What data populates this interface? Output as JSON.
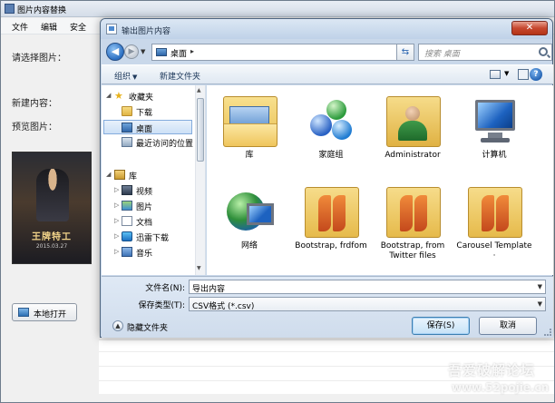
{
  "main_window": {
    "title": "图片内容替换",
    "menu": [
      "文件",
      "编辑",
      "安全"
    ],
    "labels": {
      "select_image": "请选择图片：",
      "new_content": "新建内容：",
      "preview": "预览图片："
    },
    "poster": {
      "title": "王牌特工",
      "date": "2015.03.27"
    },
    "local_open_label": "本地打开"
  },
  "dialog": {
    "title": "输出图片内容",
    "close_glyph": "✕",
    "address": {
      "location": "桌面",
      "separator": "▸"
    },
    "search_placeholder": "搜索 桌面",
    "toolbar": {
      "organize": "组织",
      "new_folder": "新建文件夹"
    },
    "nav_pane": {
      "items": [
        {
          "label": "收藏夹",
          "icon": "star-icon",
          "expander": "◢"
        },
        {
          "label": "下载",
          "icon": "folder-icon"
        },
        {
          "label": "桌面",
          "icon": "desktop-icon",
          "selected": true
        },
        {
          "label": "最近访问的位置",
          "icon": "recent-places-icon"
        },
        {
          "label": "库",
          "icon": "library-icon",
          "expander": "◢"
        },
        {
          "label": "视频",
          "icon": "video-icon",
          "expander": "▷"
        },
        {
          "label": "图片",
          "icon": "picture-icon",
          "expander": "▷"
        },
        {
          "label": "文档",
          "icon": "document-icon",
          "expander": "▷"
        },
        {
          "label": "迅雷下载",
          "icon": "download-icon",
          "expander": "▷"
        },
        {
          "label": "音乐",
          "icon": "music-icon",
          "expander": "▷"
        }
      ]
    },
    "files": [
      {
        "label": "库",
        "icon": "library-folder-icon"
      },
      {
        "label": "家庭组",
        "icon": "homegroup-icon"
      },
      {
        "label": "Administrator",
        "icon": "user-folder-icon"
      },
      {
        "label": "计算机",
        "icon": "computer-icon"
      },
      {
        "label": "网络",
        "icon": "network-icon"
      },
      {
        "label": "Bootstrap, frdfom",
        "icon": "vs-folder-icon"
      },
      {
        "label": "Bootstrap, from Twitter files",
        "icon": "vs-folder-icon"
      },
      {
        "label": "Carousel Template ·",
        "icon": "vs-folder-icon"
      }
    ],
    "filename": {
      "label": "文件名(N):",
      "value": "导出内容"
    },
    "filetype": {
      "label": "保存类型(T):",
      "value": "CSV格式 (*.csv)"
    },
    "hide_folders_label": "隐藏文件夹",
    "save_label": "保存(S)",
    "cancel_label": "取消"
  },
  "watermark": {
    "line1": "吾爱破解论坛",
    "line2": "www.52pojie.cn"
  }
}
